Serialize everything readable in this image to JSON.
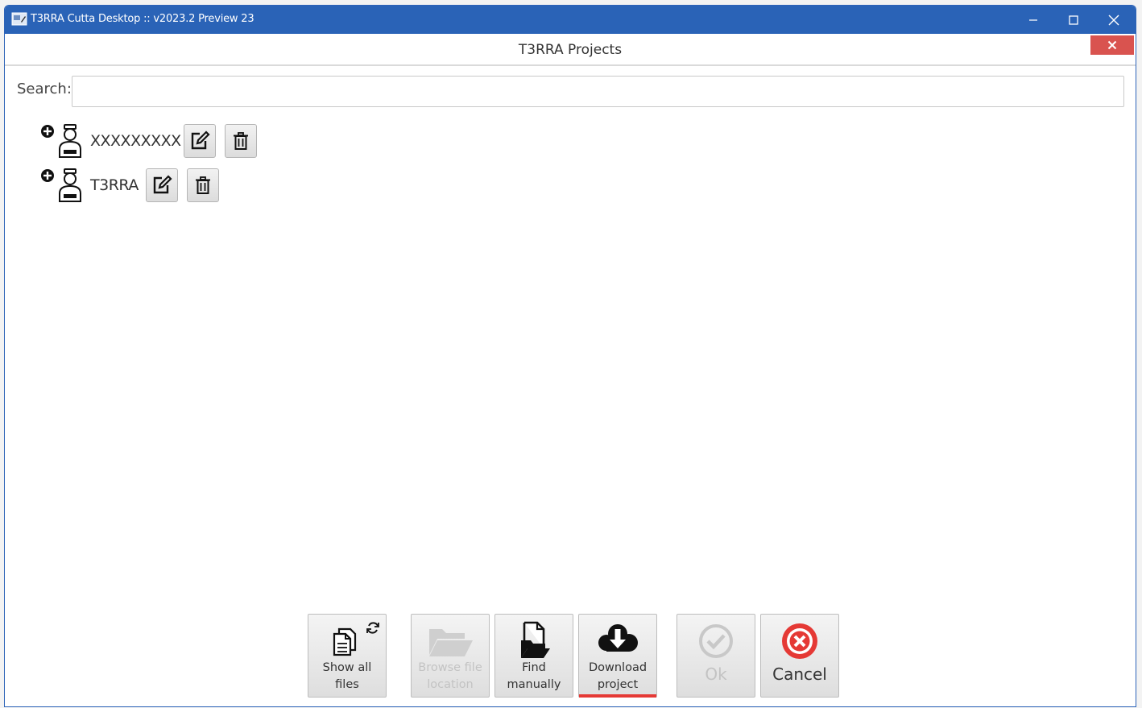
{
  "window": {
    "title": "T3RRA Cutta Desktop :: v2023.2 Preview 23",
    "minimize_icon": "minimize-icon",
    "maximize_icon": "maximize-icon",
    "close_icon": "close-icon"
  },
  "dialog": {
    "title": "T3RRA Projects",
    "close_icon": "close-icon"
  },
  "search": {
    "label": "Search:",
    "value": "",
    "placeholder": ""
  },
  "projects": [
    {
      "name": "XXXXXXXXX",
      "icons": [
        "plus-circle-icon",
        "user-icon",
        "edit-icon",
        "trash-icon"
      ]
    },
    {
      "name": "T3RRA",
      "icons": [
        "plus-circle-icon",
        "user-icon",
        "edit-icon",
        "trash-icon"
      ]
    }
  ],
  "footer": {
    "show_all": {
      "line1": "Show all",
      "line2": "files",
      "icon": "copy-files-refresh-icon"
    },
    "browse": {
      "line1": "Browse file",
      "line2": "location",
      "icon": "folder-icon",
      "disabled": true
    },
    "find": {
      "line1": "Find",
      "line2": "manually",
      "icon": "file-open-icon"
    },
    "download": {
      "line1": "Download",
      "line2": "project",
      "icon": "cloud-download-icon",
      "active": true
    },
    "ok": {
      "label": "Ok",
      "icon": "check-circle-icon",
      "disabled": true
    },
    "cancel": {
      "label": "Cancel",
      "icon": "cancel-circle-icon"
    }
  },
  "colors": {
    "titlebar": "#2a63b7",
    "dialog_close": "#d9534f",
    "active_indicator": "#e53935",
    "cancel_red": "#e53935"
  }
}
